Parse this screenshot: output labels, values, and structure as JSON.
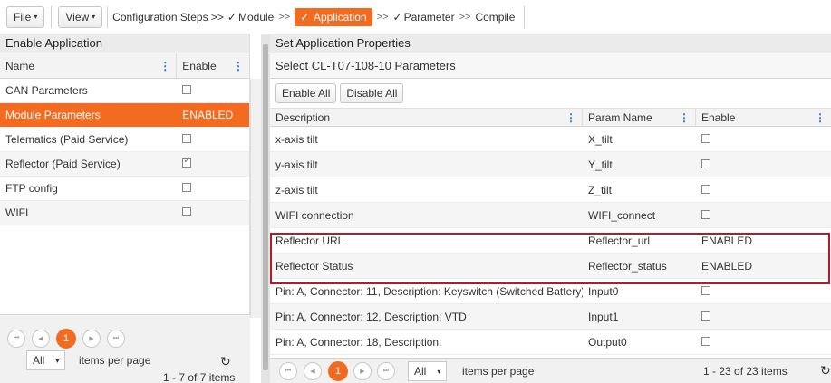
{
  "toolbar": {
    "file_label": "File",
    "view_label": "View",
    "steps_prefix": "Configuration Steps >>",
    "step_module": "Module",
    "step_application": "Application",
    "step_parameter": "Parameter",
    "step_compile": "Compile",
    "arrow": ">>",
    "check": "✓",
    "caret": "▾"
  },
  "left": {
    "title": "Enable Application",
    "col_name": "Name",
    "col_enable": "Enable",
    "rows": [
      {
        "name": "CAN Parameters",
        "enable": "checkbox-off"
      },
      {
        "name": "Module Parameters",
        "enable": "ENABLED"
      },
      {
        "name": "Telematics (Paid Service)",
        "enable": "checkbox-off"
      },
      {
        "name": "Reflector (Paid Service)",
        "enable": "checkbox-on"
      },
      {
        "name": "FTP config",
        "enable": "checkbox-off"
      },
      {
        "name": "WIFI",
        "enable": "checkbox-off"
      }
    ],
    "pager": {
      "current_page": "1",
      "page_size": "All",
      "items_per_page": "items per page",
      "summary": "1 - 7 of 7 items"
    }
  },
  "right": {
    "title": "Set Application Properties",
    "subtitle": "Select CL-T07-108-10 Parameters",
    "enable_all": "Enable All",
    "disable_all": "Disable All",
    "col_description": "Description",
    "col_param": "Param Name",
    "col_enable": "Enable",
    "rows": [
      {
        "description": "x-axis tilt",
        "param": "X_tilt",
        "enable": "checkbox-off"
      },
      {
        "description": "y-axis tilt",
        "param": "Y_tilt",
        "enable": "checkbox-off"
      },
      {
        "description": "z-axis tilt",
        "param": "Z_tilt",
        "enable": "checkbox-off"
      },
      {
        "description": "WIFI connection",
        "param": "WIFI_connect",
        "enable": "checkbox-off"
      },
      {
        "description": "Reflector URL",
        "param": "Reflector_url",
        "enable": "ENABLED"
      },
      {
        "description": "Reflector Status",
        "param": "Reflector_status",
        "enable": "ENABLED"
      },
      {
        "description": "Pin: A, Connector: 11, Description: Keyswitch (Switched Battery)",
        "param": "Input0",
        "enable": "checkbox-off"
      },
      {
        "description": "Pin: A, Connector: 12, Description: VTD",
        "param": "Input1",
        "enable": "checkbox-off"
      },
      {
        "description": "Pin: A, Connector: 18, Description:",
        "param": "Output0",
        "enable": "checkbox-off"
      }
    ],
    "pager": {
      "current_page": "1",
      "page_size": "All",
      "items_per_page": "items per page",
      "summary": "1 - 23 of 23 items"
    }
  },
  "colors": {
    "accent": "#f26b21",
    "highlight_border": "#b31b2b",
    "link_blue": "#1e73d8"
  }
}
